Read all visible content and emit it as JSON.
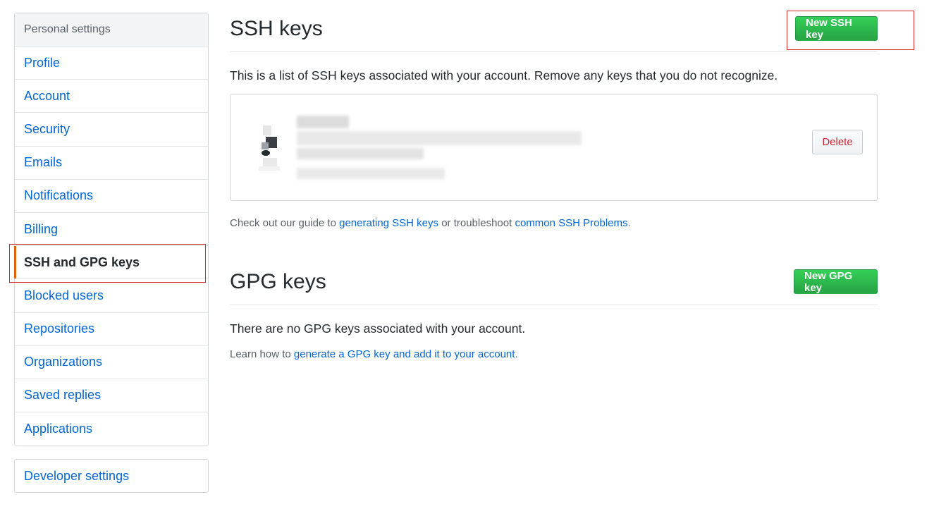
{
  "sidebar": {
    "heading": "Personal settings",
    "items": [
      {
        "label": "Profile"
      },
      {
        "label": "Account"
      },
      {
        "label": "Security"
      },
      {
        "label": "Emails"
      },
      {
        "label": "Notifications"
      },
      {
        "label": "Billing"
      },
      {
        "label": "SSH and GPG keys",
        "selected": true
      },
      {
        "label": "Blocked users"
      },
      {
        "label": "Repositories"
      },
      {
        "label": "Organizations"
      },
      {
        "label": "Saved replies"
      },
      {
        "label": "Applications"
      }
    ],
    "developer_settings": "Developer settings"
  },
  "ssh": {
    "title": "SSH keys",
    "new_button": "New SSH key",
    "description": "This is a list of SSH keys associated with your account. Remove any keys that you do not recognize.",
    "delete_button": "Delete",
    "guide_prefix": "Check out our guide to ",
    "guide_link1": "generating SSH keys",
    "guide_middle": " or troubleshoot ",
    "guide_link2": "common SSH Problems",
    "guide_suffix": "."
  },
  "gpg": {
    "title": "GPG keys",
    "new_button": "New GPG key",
    "empty_text": "There are no GPG keys associated with your account.",
    "learn_prefix": "Learn how to ",
    "learn_link": "generate a GPG key and add it to your account",
    "learn_suffix": "."
  },
  "colors": {
    "link": "#0366d6",
    "primary_button": "#28a745",
    "danger_text": "#cb2431",
    "selected_marker": "#e36209",
    "annotation": "#d9262b"
  }
}
